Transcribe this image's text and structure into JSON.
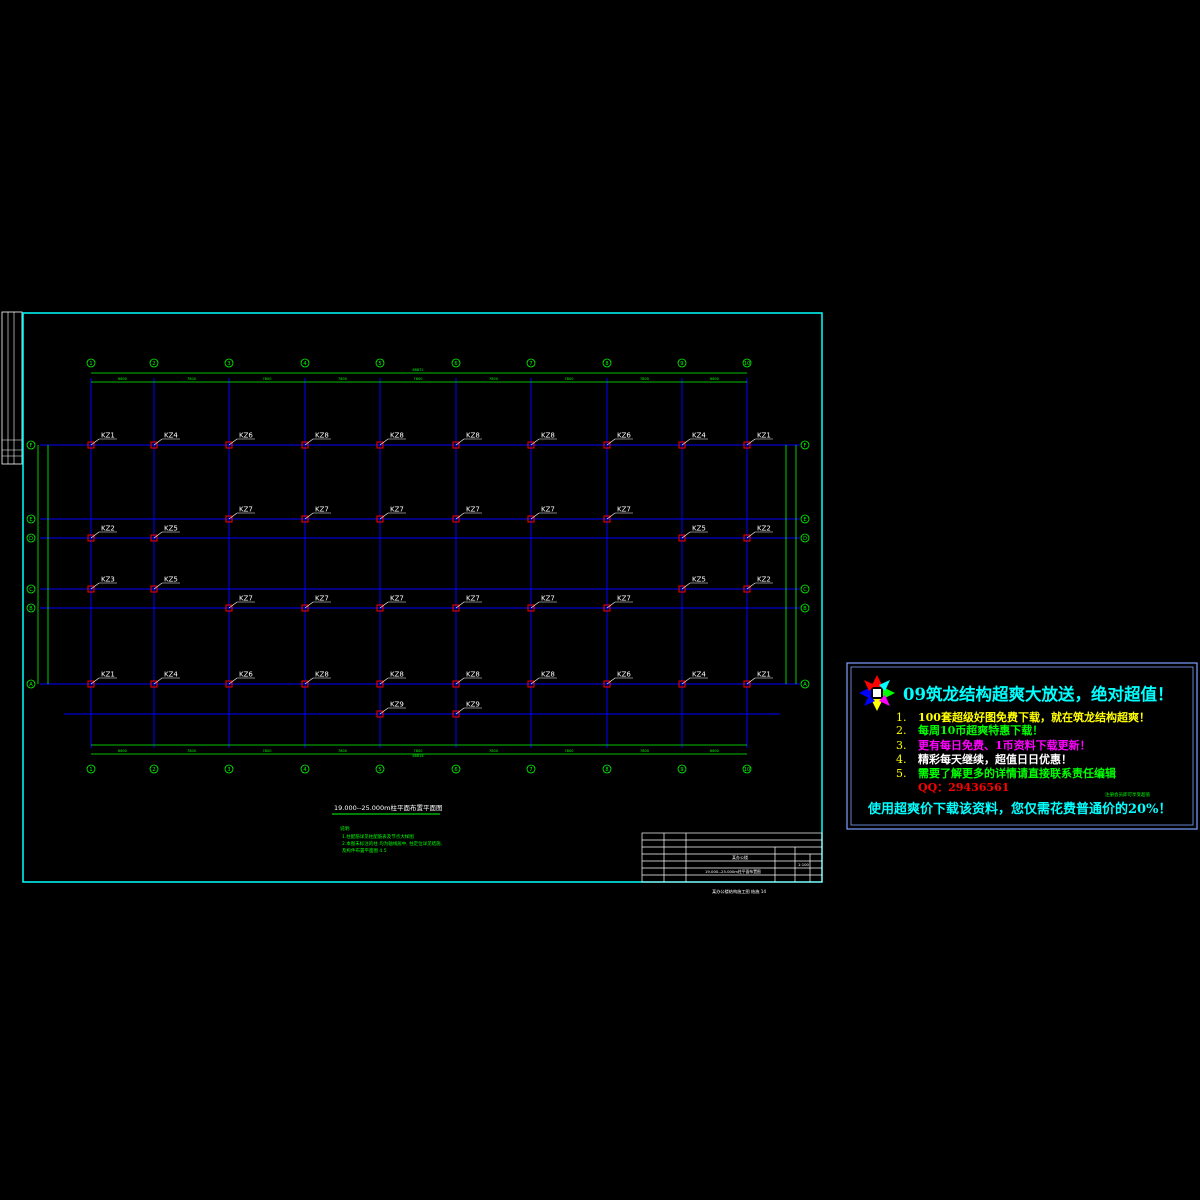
{
  "drawing": {
    "title": "19.000--25.000m柱平面布置平面图",
    "axis_labels": [
      "1",
      "2",
      "3",
      "4",
      "5",
      "6",
      "7",
      "8",
      "9",
      "10"
    ],
    "row_labels": [
      "F",
      "E",
      "D",
      "C",
      "B",
      "A"
    ],
    "top_dimensions": [
      "6600",
      "7800",
      "7800",
      "7800",
      "7800",
      "7800",
      "7800",
      "7800",
      "6600"
    ],
    "top_total": "68872",
    "bottom_dimensions": [
      "6600",
      "7800",
      "7800",
      "7800",
      "7800",
      "7800",
      "7800",
      "7800",
      "6600"
    ],
    "bottom_total": "68816",
    "column_rows": [
      {
        "row": "F",
        "labels": [
          "KZ1",
          "KZ4",
          "KZ6",
          "KZ8",
          "KZ8",
          "KZ8",
          "KZ8",
          "KZ6",
          "KZ4",
          "KZ1"
        ]
      },
      {
        "row": "E-upper",
        "labels": [
          "",
          "",
          "KZ7",
          "KZ7",
          "KZ7",
          "KZ7",
          "KZ7",
          "KZ7",
          "",
          ""
        ]
      },
      {
        "row": "E",
        "labels": [
          "KZ2",
          "KZ5",
          "",
          "",
          "",
          "",
          "",
          "",
          "KZ5",
          "KZ2"
        ]
      },
      {
        "row": "C",
        "labels": [
          "KZ3",
          "KZ5",
          "",
          "",
          "",
          "",
          "",
          "",
          "KZ5",
          "KZ2"
        ]
      },
      {
        "row": "C-lower",
        "labels": [
          "",
          "",
          "KZ7",
          "KZ7",
          "KZ7",
          "KZ7",
          "KZ7",
          "KZ7",
          "",
          ""
        ]
      },
      {
        "row": "A",
        "labels": [
          "KZ1",
          "KZ4",
          "KZ6",
          "KZ8",
          "KZ8",
          "KZ8",
          "KZ8",
          "KZ6",
          "KZ4",
          "KZ1"
        ]
      },
      {
        "row": "A-lower",
        "labels": [
          "",
          "",
          "",
          "",
          "KZ9",
          "KZ9",
          "",
          "",
          "",
          ""
        ]
      }
    ],
    "notes_heading": "说明:",
    "notes": [
      "1.柱配筋详见柱配筋表及节点大样图",
      "2.本图未标注的柱 均为轴线居中, 柱定位详见结施,",
      "  及构件布置平面图 4.5"
    ],
    "title_block": {
      "project": "某办公楼",
      "drawing_name": "19.000--25.000m柱平面布置图",
      "scale": "1:100",
      "footer": "某办公楼结构施工图 结施 14"
    }
  },
  "ad_panel": {
    "title": "09筑龙结构超爽大放送，绝对超值！",
    "items": [
      {
        "num": "1.",
        "text": "100套超级好图免费下载，就在筑龙结构超爽！",
        "color": "#ffff00"
      },
      {
        "num": "2.",
        "text": "每周10币超爽特惠下载！",
        "color": "#00ff00"
      },
      {
        "num": "3.",
        "text": "更有每日免费、1币资料下载更新！",
        "color": "#ff00ff"
      },
      {
        "num": "4.",
        "text": "精彩每天继续，超值日日优惠！",
        "color": "#ffffff"
      },
      {
        "num": "5.",
        "text": "需要了解更多的详情请直接联系责任编辑",
        "color": "#00ff00"
      }
    ],
    "qq": "QQ：29436561",
    "small_note": "注册会员即可享受超值",
    "footer": "使用超爽价下载该资料，您仅需花费普通价的20%！",
    "colors": {
      "border": "#7f9fff",
      "title": "#00ffff",
      "footer": "#00ffff",
      "qq": "#ff0000",
      "num": "#ffff00"
    }
  },
  "colors": {
    "frame": "#00ffff",
    "grid": "#0000ff",
    "dimension": "#00ff00",
    "column": "#ff0000",
    "label": "#ffffff"
  }
}
